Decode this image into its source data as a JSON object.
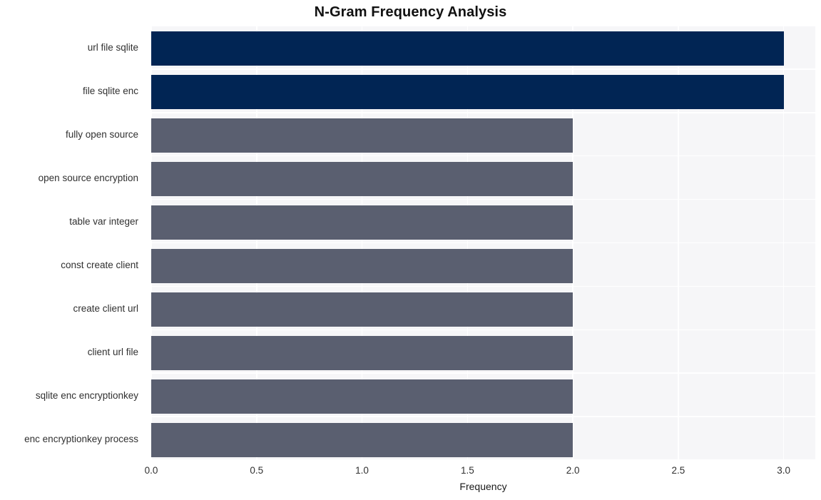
{
  "chart_data": {
    "type": "bar",
    "orientation": "horizontal",
    "title": "N-Gram Frequency Analysis",
    "xlabel": "Frequency",
    "ylabel": "",
    "categories": [
      "url file sqlite",
      "file sqlite enc",
      "fully open source",
      "open source encryption",
      "table var integer",
      "const create client",
      "create client url",
      "client url file",
      "sqlite enc encryptionkey",
      "enc encryptionkey process"
    ],
    "values": [
      3,
      3,
      2,
      2,
      2,
      2,
      2,
      2,
      2,
      2
    ],
    "bar_colors": [
      "#012554",
      "#012554",
      "#5a5f70",
      "#5a5f70",
      "#5a5f70",
      "#5a5f70",
      "#5a5f70",
      "#5a5f70",
      "#5a5f70",
      "#5a5f70"
    ],
    "xlim": [
      0.0,
      3.15
    ],
    "xticks": [
      0.0,
      0.5,
      1.0,
      1.5,
      2.0,
      2.5,
      3.0
    ],
    "xtick_labels": [
      "0.0",
      "0.5",
      "1.0",
      "1.5",
      "2.0",
      "2.5",
      "3.0"
    ],
    "grid": true,
    "grid_color": "#ffffff",
    "plot_background": "#f6f6f8",
    "figure_background": "#ffffff",
    "legend": null
  }
}
